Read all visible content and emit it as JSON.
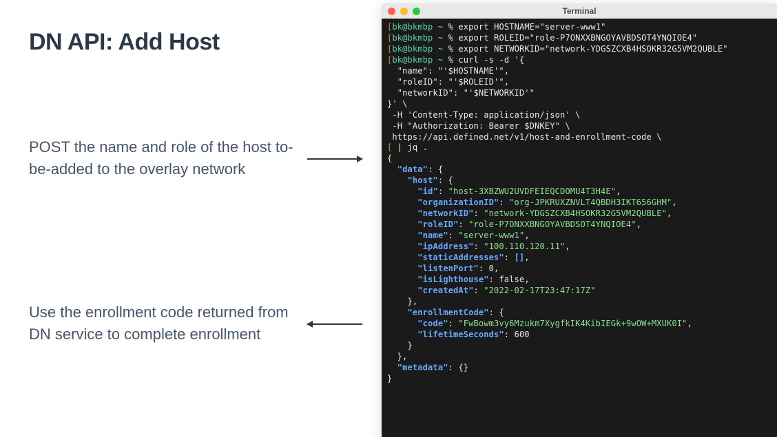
{
  "heading": "DN API: Add Host",
  "caption1": "POST the name and role of the host to-be-added to the overlay network",
  "caption2": "Use the enrollment code returned from DN service to complete enrollment",
  "terminal": {
    "title": "Terminal",
    "prompt_user": "bk@bkmbp",
    "prompt_path": "~",
    "prompt_symbol": "%",
    "lines": {
      "l1_cmd": "export HOSTNAME=\"server-www1\"",
      "l2_cmd": "export ROLEID=\"role-P7ONXXBNGOYAVBDSOT4YNQIOE4\"",
      "l3_cmd": "export NETWORKID=\"network-YDGSZCXB4HSOKR32G5VM2QUBLE\"",
      "l4_cmd": "curl -s -d '{",
      "body_name": "  \"name\": \"'$HOSTNAME'\",",
      "body_role": "  \"roleID\": \"'$ROLEID'\",",
      "body_net": "  \"networkID\": \"'$NETWORKID'\"",
      "body_end": "}' \\",
      "hdr1": " -H 'Content-Type: application/json' \\",
      "hdr2": " -H \"Authorization: Bearer $DNKEY\" \\",
      "url": " https://api.defined.net/v1/host-and-enrollment-code \\",
      "pipe": " | jq .",
      "json": {
        "open": "{",
        "data_k": "\"data\"",
        "data_open": ": {",
        "host_k": "\"host\"",
        "host_open": ": {",
        "id_k": "\"id\"",
        "id_v": "\"host-3XBZWU2UVDFEIEQCDOMU4T3H4E\"",
        "org_k": "\"organizationID\"",
        "org_v": "\"org-JPKRUXZNVLT4QBDH3IKT656GHM\"",
        "net_k": "\"networkID\"",
        "net_v": "\"network-YDGSZCXB4HSOKR32G5VM2QUBLE\"",
        "role_k": "\"roleID\"",
        "role_v": "\"role-P7ONXXBNGOYAVBDSOT4YNQIOE4\"",
        "name_k": "\"name\"",
        "name_v": "\"server-www1\"",
        "ip_k": "\"ipAddress\"",
        "ip_v": "\"100.110.120.11\"",
        "sa_k": "\"staticAddresses\"",
        "sa_v": "[]",
        "lp_k": "\"listenPort\"",
        "lp_v": "0",
        "lh_k": "\"isLighthouse\"",
        "lh_v": "false",
        "ca_k": "\"createdAt\"",
        "ca_v": "\"2022-02-17T23:47:17Z\"",
        "host_close": "},",
        "ec_k": "\"enrollmentCode\"",
        "ec_open": ": {",
        "code_k": "\"code\"",
        "code_v": "\"FwBowm3vy6Mzukm7XygfkIK4KibIEGk+9wOW+MXUK0I\"",
        "ls_k": "\"lifetimeSeconds\"",
        "ls_v": "600",
        "ec_close": "}",
        "data_close": "},",
        "meta_k": "\"metadata\"",
        "meta_v": ": {}",
        "close": "}"
      }
    }
  }
}
